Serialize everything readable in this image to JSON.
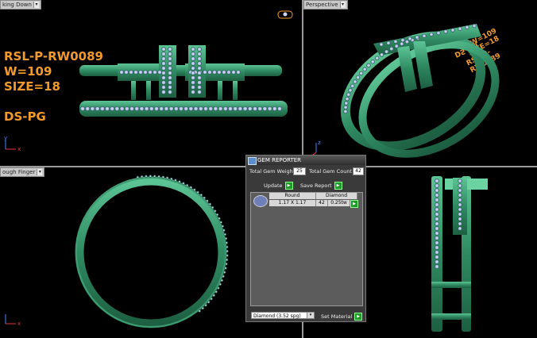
{
  "viewports": {
    "top_left": {
      "tab": "king Down"
    },
    "top_right": {
      "tab": "Perspective"
    },
    "bottom_left": {
      "tab": "ough Finger"
    },
    "bottom_right": {
      "tab": ""
    }
  },
  "ring_info": {
    "code": "RSL-P-RW0089",
    "weight": "W=109",
    "size": "SIZE=18",
    "finish": "DS-PG"
  },
  "mirrored_text": {
    "l1": "DS-PG",
    "l2": "W=109",
    "l3": "SIZE=18",
    "l4": "RSL-P-RW0089"
  },
  "axes": {
    "x": "x",
    "z": "z",
    "y": "y"
  },
  "gem_reporter": {
    "title": "GEM REPORTER",
    "total_gem_weight_label": "Total Gem Weight",
    "total_gem_weight_value": "25",
    "total_gem_count_label": "Total Gem Count",
    "total_gem_count_value": "42",
    "update_label": "Update",
    "save_report_label": "Save Report",
    "columns": [
      "Round",
      "Diamond"
    ],
    "rows": [
      {
        "shape": "1.17 X 1.17",
        "count": "42",
        "weight": "0.25tw"
      }
    ],
    "material_select": "Diamond    (3.52 spg)",
    "set_material_label": "Set Material"
  },
  "colors": {
    "metal": "#2f8a62",
    "metal_light": "#4fb888",
    "gem": "#a9b8e6",
    "label": "#f29a2e"
  }
}
